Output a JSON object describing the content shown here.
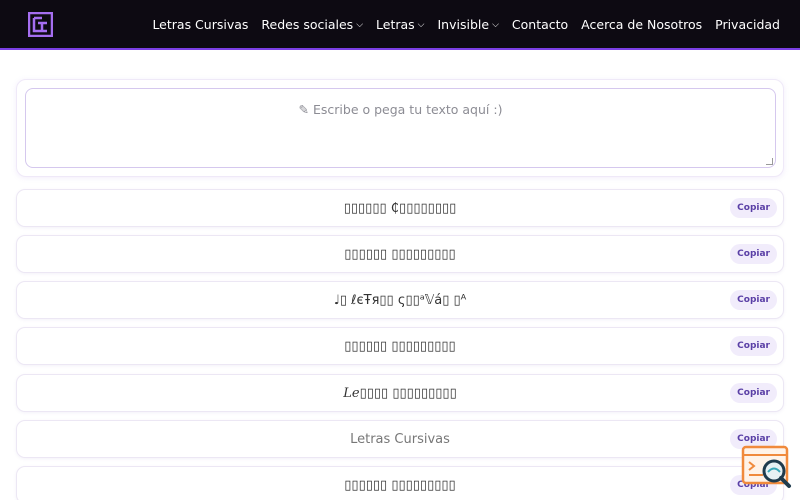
{
  "nav": {
    "items": [
      {
        "label": "Letras Cursivas",
        "dropdown": false
      },
      {
        "label": "Redes sociales",
        "dropdown": true
      },
      {
        "label": "Letras",
        "dropdown": true
      },
      {
        "label": "Invisible",
        "dropdown": true
      },
      {
        "label": "Contacto",
        "dropdown": false
      },
      {
        "label": "Acerca de Nosotros",
        "dropdown": false
      },
      {
        "label": "Privacidad",
        "dropdown": false
      }
    ],
    "chevron": "⌵"
  },
  "colors": {
    "accent": "#7b3fe4",
    "topbar": "#0d0a12"
  },
  "input": {
    "placeholder": "✎ Escribe o pega tu texto aquí :)"
  },
  "results": [
    {
      "text": "▯▯▯▯▯▯ ₵▯▯▯▯▯▯▯▯",
      "copy": "Copiar"
    },
    {
      "text": "▯▯▯▯▯▯ ▯▯▯▯▯▯▯▯▯",
      "copy": "Copiar"
    },
    {
      "text": "♩▯ ℓєŦя▯▯ ς▯▯ᵃ𝕍á▯ ▯ᴬ",
      "copy": "Copiar"
    },
    {
      "text": "▯▯▯▯▯▯ ▯▯▯▯▯▯▯▯▯",
      "copy": "Copiar"
    },
    {
      "text": "𝐿𝑒▯▯▯▯ ▯▯▯▯▯▯▯▯▯",
      "copy": "Copiar"
    },
    {
      "text": "Letras Cursivas",
      "copy": "Copiar"
    },
    {
      "text": "▯▯▯▯▯▯ ▯▯▯▯▯▯▯▯▯",
      "copy": "Copiar"
    }
  ],
  "icons": {
    "logo": "letter-logo-icon",
    "floating": "code-search-icon"
  }
}
